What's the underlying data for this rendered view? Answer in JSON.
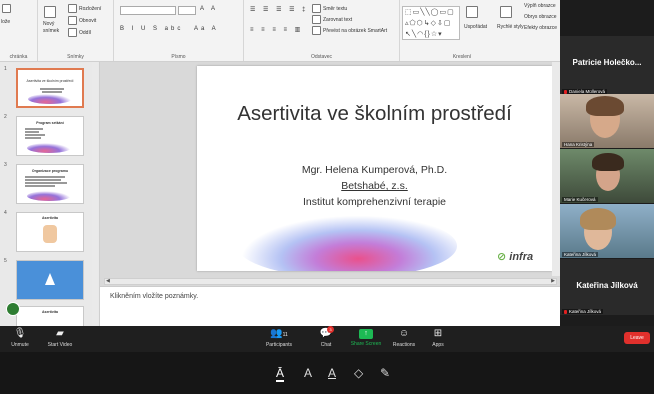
{
  "ribbon": {
    "slide_label": "lože",
    "new_slide": "Nový",
    "new_slide_line2": "snímek",
    "layout": "Rozložení",
    "reset": "Obnovit",
    "section": "Oddíl",
    "group_clipboard": "chránka",
    "group_slides": "Snímky",
    "group_font": "Písmo",
    "group_paragraph": "Odstavec",
    "group_drawing": "Kreslení",
    "text_direction": "Směr textu",
    "align_text": "Zarovnat text",
    "smartart": "Převést na obrázek SmartArt",
    "arrange": "Uspořádat",
    "quick_styles": "Rychlé styly",
    "shape_fill": "Výplň obrazce",
    "shape_outline": "Obrys obrazce",
    "shape_effects": "Efekty obrazce",
    "find": "Najít",
    "replace": "Nahradit",
    "font_format": "B I U S abc",
    "shapes_rows": [
      "⬚▭╲╲◯▭▢",
      "▵⬠⬡↳◇⇩▢",
      "↖╲◠{}☆▾"
    ]
  },
  "sidebar": {
    "thumbs": [
      {
        "num": "1",
        "title": "Asertivita ve školním prostředí"
      },
      {
        "num": "2",
        "title": "Program setkání"
      },
      {
        "num": "3",
        "title": "Organizace programu"
      },
      {
        "num": "4",
        "title": "Asertivita"
      },
      {
        "num": "5",
        "title": ""
      },
      {
        "num": "6",
        "title": "Asertivita"
      }
    ]
  },
  "slide": {
    "title": "Asertivita ve školním prostředí",
    "author": "Mgr. Helena Kumperová, Ph.D.",
    "org": "Betshabé, z.s.",
    "institute": "Institut komprehenzivní terapie",
    "logo": "infra"
  },
  "notes": {
    "placeholder": "Klikněním vložíte poznámky."
  },
  "panel": {
    "top_name": "Patricie Holečko...",
    "tiles": [
      {
        "name": "Daniela Müllerová"
      },
      {
        "name": "Hana Kristýna"
      },
      {
        "name": "Marie Kučerová"
      },
      {
        "name": "Kateřina Jílková"
      }
    ],
    "bottom_big": "Kateřina Jílková",
    "bottom_name": "Kateřina Jílková"
  },
  "toolbar": {
    "unmute": "Unmute",
    "start_video": "Start Video",
    "participants": "Participants",
    "participants_count": "11",
    "chat": "Chat",
    "chat_badge": "3",
    "share": "Share Screen",
    "reactions": "Reactions",
    "apps": "Apps",
    "leave": "Leave"
  },
  "colors": {
    "accent_red": "#e0302c",
    "share_green": "#1db954",
    "thumb_selected": "#e07a50"
  }
}
